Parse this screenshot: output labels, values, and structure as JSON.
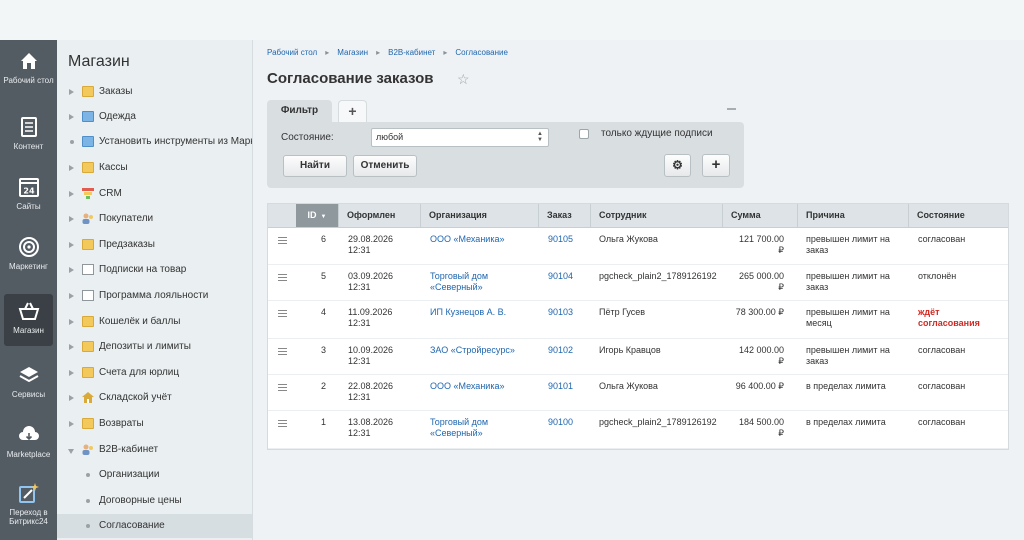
{
  "rail": [
    {
      "label": "Рабочий стол",
      "icon": "home-icon"
    },
    {
      "label": "Контент",
      "icon": "document-icon"
    },
    {
      "label": "Сайты",
      "icon": "calendar-24-icon"
    },
    {
      "label": "Маркетинг",
      "icon": "target-icon"
    },
    {
      "label": "Магазин",
      "icon": "basket-icon"
    },
    {
      "label": "Сервисы",
      "icon": "layers-icon"
    },
    {
      "label": "Marketplace",
      "icon": "cloud-download-icon"
    },
    {
      "label": "Переход в Битрикс24",
      "icon": "magic-wand-icon"
    }
  ],
  "menu": {
    "title": "Магазин",
    "items": [
      {
        "label": "Заказы",
        "icon": "folder-doc-icon"
      },
      {
        "label": "Одежда",
        "icon": "folder-blue-icon"
      },
      {
        "label": "Установить инструменты из Маркетплейса",
        "icon": "bullet"
      },
      {
        "label": "Кассы",
        "icon": "folder-icon"
      },
      {
        "label": "CRM",
        "icon": "funnel-icon"
      },
      {
        "label": "Покупатели",
        "icon": "users-icon"
      },
      {
        "label": "Предзаказы",
        "icon": "folder-icon"
      },
      {
        "label": "Подписки на товар",
        "icon": "doc-icon"
      },
      {
        "label": "Программа лояльности",
        "icon": "doc-icon"
      },
      {
        "label": "Кошелёк и баллы",
        "icon": "folder-icon"
      },
      {
        "label": "Депозиты и лимиты",
        "icon": "folder-icon"
      },
      {
        "label": "Счета для юрлиц",
        "icon": "folder-icon"
      },
      {
        "label": "Складской учёт",
        "icon": "house-icon"
      },
      {
        "label": "Возвраты",
        "icon": "folder-icon"
      },
      {
        "label": "B2B-кабинет",
        "icon": "users-icon"
      },
      {
        "label": "Организации",
        "icon": "sub-bullet"
      },
      {
        "label": "Договорные цены",
        "icon": "sub-bullet"
      },
      {
        "label": "Согласование",
        "icon": "sub-bullet"
      }
    ]
  },
  "breadcrumb": [
    "Рабочий стол",
    "Магазин",
    "B2B-кабинет",
    "Согласование"
  ],
  "page_title": "Согласование заказов",
  "filter": {
    "tab_label": "Фильтр",
    "add_tab": "+",
    "state_label": "Состояние:",
    "state_value": "любой",
    "checkbox_label": "только ждущие подписи",
    "find_label": "Найти",
    "cancel_label": "Отменить",
    "gear": "⚙",
    "plus": "+"
  },
  "table": {
    "columns": [
      "ID",
      "Оформлен",
      "Организация",
      "Заказ",
      "Сотрудник",
      "Сумма",
      "Причина",
      "Состояние"
    ],
    "rows": [
      {
        "id": "6",
        "date": "29.08.2026",
        "time": "12:31",
        "org": "ООО «Механика»",
        "org2": "",
        "order": "90105",
        "employee": "Ольга Жукова",
        "sum": "121 700.00",
        "cur": "₽",
        "reason": "превышен лимит на",
        "reason2": "заказ",
        "status": "согласован",
        "status2": "",
        "status_color": "normal"
      },
      {
        "id": "5",
        "date": "03.09.2026",
        "time": "12:31",
        "org": "Торговый дом",
        "org2": "«Северный»",
        "order": "90104",
        "employee": "pgcheck_plain2_1789126192",
        "sum": "265 000.00",
        "cur": "₽",
        "reason": "превышен лимит на",
        "reason2": "заказ",
        "status": "отклонён",
        "status2": "",
        "status_color": "normal"
      },
      {
        "id": "4",
        "date": "11.09.2026",
        "time": "12:31",
        "org": "ИП Кузнецов А. В.",
        "org2": "",
        "order": "90103",
        "employee": "Пётр Гусев",
        "sum": "78 300.00 ₽",
        "cur": "",
        "reason": "превышен лимит на",
        "reason2": "месяц",
        "status": "ждёт",
        "status2": "согласования",
        "status_color": "red"
      },
      {
        "id": "3",
        "date": "10.09.2026",
        "time": "12:31",
        "org": "ЗАО «Стройресурс»",
        "org2": "",
        "order": "90102",
        "employee": "Игорь Кравцов",
        "sum": "142 000.00",
        "cur": "₽",
        "reason": "превышен лимит на",
        "reason2": "заказ",
        "status": "согласован",
        "status2": "",
        "status_color": "normal"
      },
      {
        "id": "2",
        "date": "22.08.2026",
        "time": "12:31",
        "org": "ООО «Механика»",
        "org2": "",
        "order": "90101",
        "employee": "Ольга Жукова",
        "sum": "96 400.00 ₽",
        "cur": "",
        "reason": "в пределах лимита",
        "reason2": "",
        "status": "согласован",
        "status2": "",
        "status_color": "normal"
      },
      {
        "id": "1",
        "date": "13.08.2026",
        "time": "12:31",
        "org": "Торговый дом",
        "org2": "«Северный»",
        "order": "90100",
        "employee": "pgcheck_plain2_1789126192",
        "sum": "184 500.00",
        "cur": "₽",
        "reason": "в пределах лимита",
        "reason2": "",
        "status": "согласован",
        "status2": "",
        "status_color": "normal"
      }
    ]
  },
  "colors": {
    "link": "#2067b0",
    "alert": "#d12a22",
    "rail": "#545c63"
  }
}
